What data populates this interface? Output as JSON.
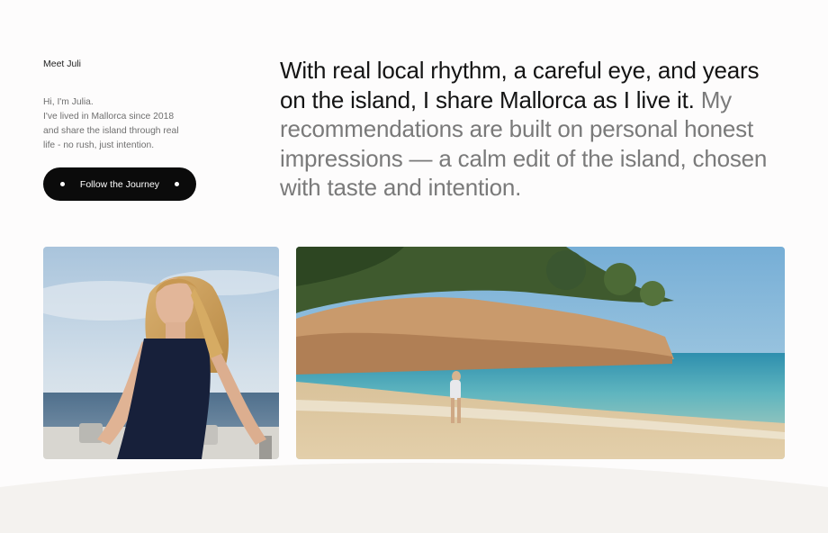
{
  "intro": {
    "heading": "Meet Juli",
    "bio_lines": [
      "Hi, I'm Julia.",
      "I've lived in Mallorca since 2018",
      "and share the island through real",
      "life - no rush, just intention."
    ]
  },
  "cta": {
    "label": "Follow the Journey"
  },
  "headline": {
    "dark_lines": [
      "With real local rhythm, a careful eye, and years",
      "on the island, I share Mallorca as I live it."
    ],
    "dark_tail_suffix": " My",
    "grey_lines": [
      "recommendations are built on personal honest",
      "impressions — a calm edit of the island, chosen",
      "with taste and intention."
    ]
  },
  "colors": {
    "background": "#fdfcfc",
    "button": "#0b0b0b",
    "text_dark": "#141414",
    "text_grey": "#7a7a7a",
    "footer": "#f4f2ef"
  }
}
